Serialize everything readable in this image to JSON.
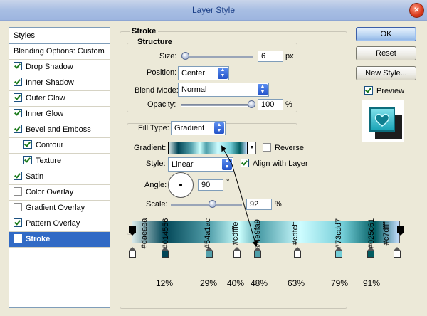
{
  "window": {
    "title": "Layer Style",
    "close_glyph": "✕"
  },
  "styles_panel": {
    "header": "Styles",
    "blending": "Blending Options: Custom",
    "items": [
      {
        "label": "Drop Shadow",
        "checked": true
      },
      {
        "label": "Inner Shadow",
        "checked": true
      },
      {
        "label": "Outer Glow",
        "checked": true
      },
      {
        "label": "Inner Glow",
        "checked": true
      },
      {
        "label": "Bevel and Emboss",
        "checked": true
      },
      {
        "label": "Contour",
        "checked": true
      },
      {
        "label": "Texture",
        "checked": true
      },
      {
        "label": "Satin",
        "checked": true
      },
      {
        "label": "Color Overlay",
        "checked": false
      },
      {
        "label": "Gradient Overlay",
        "checked": false
      },
      {
        "label": "Pattern Overlay",
        "checked": true
      },
      {
        "label": "Stroke",
        "checked": true
      }
    ]
  },
  "stroke": {
    "title": "Stroke",
    "structure": {
      "title": "Structure",
      "size_label": "Size:",
      "size_value": "6",
      "size_unit": "px",
      "position_label": "Position:",
      "position_value": "Center",
      "blend_label": "Blend Mode:",
      "blend_value": "Normal",
      "opacity_label": "Opacity:",
      "opacity_value": "100",
      "opacity_unit": "%"
    },
    "fill": {
      "fill_type_label": "Fill Type:",
      "fill_type_value": "Gradient",
      "gradient_label": "Gradient:",
      "reverse_label": "Reverse",
      "style_label": "Style:",
      "style_value": "Linear",
      "align_label": "Align with Layer",
      "angle_label": "Angle:",
      "angle_value": "90",
      "angle_unit": "°",
      "scale_label": "Scale:",
      "scale_value": "92",
      "scale_unit": "%"
    }
  },
  "buttons": {
    "ok": "OK",
    "reset": "Reset",
    "new_style": "New Style...",
    "preview": "Preview"
  },
  "gradient_stops": [
    {
      "hex": "#daeaea",
      "pct": ""
    },
    {
      "hex": "#014556",
      "pct": "12%"
    },
    {
      "hex": "#54a1ac",
      "pct": "29%"
    },
    {
      "hex": "#cdfffe",
      "pct": "40%"
    },
    {
      "hex": "#4e9fa9",
      "pct": "48%"
    },
    {
      "hex": "#cdfcff",
      "pct": "63%"
    },
    {
      "hex": "#73cdd7",
      "pct": "79%"
    },
    {
      "hex": "#025c61",
      "pct": "91%"
    },
    {
      "hex": "#c7dfff",
      "pct": ""
    }
  ]
}
